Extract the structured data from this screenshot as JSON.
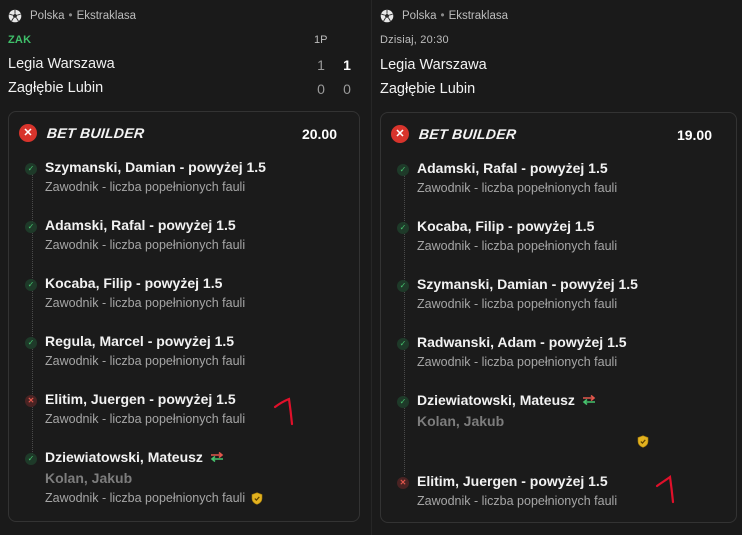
{
  "left": {
    "league": {
      "country": "Polska",
      "sep": "•",
      "competition": "Ekstraklasa"
    },
    "status": "ZAK",
    "period_label": "1P",
    "teams": [
      {
        "name": "Legia Warszawa",
        "score_1p": "1",
        "score_total": "1"
      },
      {
        "name": "Zagłębie Lubin",
        "score_1p": "0",
        "score_total": "0"
      }
    ],
    "bet": {
      "title": "BET BUILDER",
      "odds": "20.00",
      "legs": [
        {
          "title": "Szymanski, Damian - powyżej 1.5",
          "subtitle": "Zawodnik - liczba popełnionych fauli",
          "status": "won"
        },
        {
          "title": "Adamski, Rafal - powyżej 1.5",
          "subtitle": "Zawodnik - liczba popełnionych fauli",
          "status": "won"
        },
        {
          "title": "Kocaba, Filip - powyżej 1.5",
          "subtitle": "Zawodnik - liczba popełnionych fauli",
          "status": "won"
        },
        {
          "title": "Regula, Marcel - powyżej 1.5",
          "subtitle": "Zawodnik - liczba popełnionych fauli",
          "status": "won"
        },
        {
          "title": "Elitim, Juergen - powyżej 1.5",
          "subtitle": "Zawodnik - liczba popełnionych fauli",
          "status": "lost"
        },
        {
          "title": "Dziewiatowski, Mateusz",
          "replacement": "Kolan, Jakub",
          "subtitle": "Zawodnik - liczba popełnionych fauli",
          "status": "won"
        }
      ]
    }
  },
  "right": {
    "league": {
      "country": "Polska",
      "sep": "•",
      "competition": "Ekstraklasa"
    },
    "status": "Dzisiaj, 20:30",
    "teams": [
      {
        "name": "Legia Warszawa"
      },
      {
        "name": "Zagłębie Lubin"
      }
    ],
    "bet": {
      "title": "BET BUILDER",
      "odds": "19.00",
      "legs": [
        {
          "title": "Adamski, Rafal - powyżej 1.5",
          "subtitle": "Zawodnik - liczba popełnionych fauli",
          "status": "won"
        },
        {
          "title": "Kocaba, Filip - powyżej 1.5",
          "subtitle": "Zawodnik - liczba popełnionych fauli",
          "status": "won"
        },
        {
          "title": "Szymanski, Damian - powyżej 1.5",
          "subtitle": "Zawodnik - liczba popełnionych fauli",
          "status": "won"
        },
        {
          "title": "Radwanski, Adam - powyżej 1.5",
          "subtitle": "Zawodnik - liczba popełnionych fauli",
          "status": "won"
        },
        {
          "title": "Dziewiatowski, Mateusz",
          "replacement": "Kolan, Jakub",
          "status": "won"
        },
        {
          "title": "Elitim, Juergen - powyżej 1.5",
          "subtitle": "Zawodnik - liczba popełnionych fauli",
          "status": "lost"
        }
      ]
    }
  },
  "icons": {
    "league": "soccer-ball-icon",
    "won": "check-icon",
    "lost": "cross-icon",
    "substitution": "swap-arrows-icon",
    "bet_builder_status": "cross-badge-icon",
    "shield": "shield-icon"
  },
  "colors": {
    "won": "#46c26d",
    "lost": "#e2574c",
    "live_status": "#3fbf6a",
    "badge": "#d8342c",
    "annotation": "#e0102a"
  }
}
